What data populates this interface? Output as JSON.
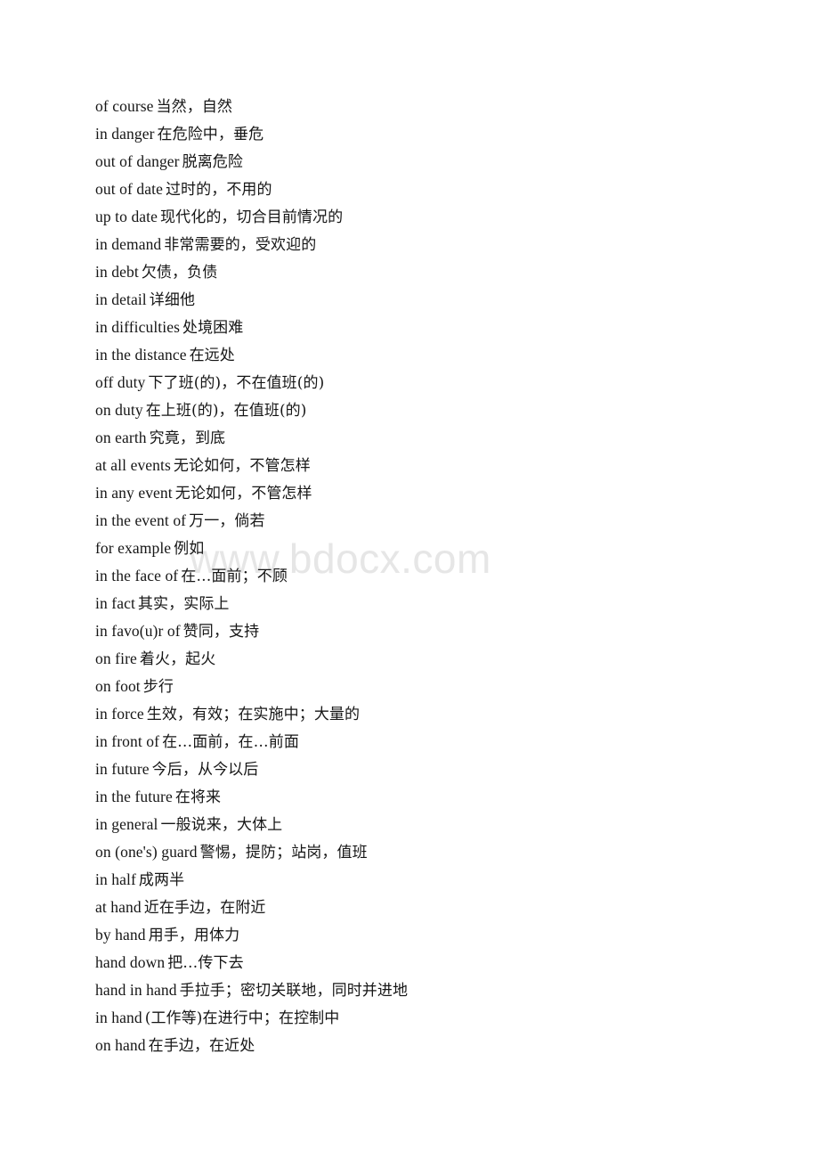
{
  "document": {
    "kind": "vocabulary-list",
    "background_color": "#ffffff",
    "text_color": "#161616"
  },
  "watermark": {
    "text": "www.bdocx.com",
    "color": "#e6e6e6"
  },
  "entries": [
    {
      "term": "of course",
      "gloss": "当然，自然"
    },
    {
      "term": "in danger",
      "gloss": "在危险中，垂危"
    },
    {
      "term": "out of danger",
      "gloss": "脱离危险"
    },
    {
      "term": "out of date",
      "gloss": "过时的，不用的"
    },
    {
      "term": "up to date",
      "gloss": "现代化的，切合目前情况的"
    },
    {
      "term": "in demand",
      "gloss": "非常需要的，受欢迎的"
    },
    {
      "term": "in debt",
      "gloss": "欠债，负债"
    },
    {
      "term": "in detail",
      "gloss": "详细他"
    },
    {
      "term": "in difficulties",
      "gloss": "处境困难"
    },
    {
      "term": "in the distance",
      "gloss": "在远处"
    },
    {
      "term": "off duty",
      "gloss": "下了班(的)，不在值班(的)"
    },
    {
      "term": "on duty",
      "gloss": "在上班(的)，在值班(的)"
    },
    {
      "term": "on earth",
      "gloss": "究竟，到底"
    },
    {
      "term": "at all events",
      "gloss": "无论如何，不管怎样"
    },
    {
      "term": "in any event",
      "gloss": "无论如何，不管怎样"
    },
    {
      "term": "in the event of",
      "gloss": "万一，倘若"
    },
    {
      "term": "for example",
      "gloss": "例如"
    },
    {
      "term": "in the face of",
      "gloss": "在…面前；不顾"
    },
    {
      "term": "in fact",
      "gloss": "其实，实际上"
    },
    {
      "term": "in favo(u)r of",
      "gloss": "赞同，支持"
    },
    {
      "term": "on fire",
      "gloss": "着火，起火"
    },
    {
      "term": "on foot",
      "gloss": "步行"
    },
    {
      "term": "in force",
      "gloss": "生效，有效；在实施中；大量的"
    },
    {
      "term": "in front of",
      "gloss": "在…面前，在…前面"
    },
    {
      "term": "in future",
      "gloss": "今后，从今以后"
    },
    {
      "term": "in the future",
      "gloss": "在将来"
    },
    {
      "term": "in general",
      "gloss": "一般说来，大体上"
    },
    {
      "term": "on (one's) guard",
      "gloss": "警惕，提防；站岗，值班"
    },
    {
      "term": "in half",
      "gloss": "成两半"
    },
    {
      "term": "at hand",
      "gloss": "近在手边，在附近"
    },
    {
      "term": "by hand",
      "gloss": "用手，用体力"
    },
    {
      "term": "hand down",
      "gloss": "把…传下去"
    },
    {
      "term": "hand in hand",
      "gloss": "手拉手；密切关联地，同时并进地"
    },
    {
      "term": "in hand",
      "gloss": "(工作等)在进行中；在控制中"
    },
    {
      "term": "on hand",
      "gloss": "在手边，在近处"
    }
  ]
}
